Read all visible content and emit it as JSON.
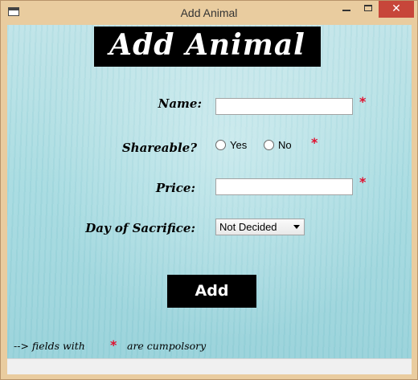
{
  "window": {
    "title": "Add Animal",
    "close_glyph": "✕"
  },
  "form": {
    "heading": "Add Animal",
    "name_label": "Name:",
    "shareable_label": "Shareable?",
    "price_label": "Price:",
    "day_label": "Day of Sacrifice:",
    "name_value": "",
    "price_value": "",
    "radio_yes": "Yes",
    "radio_no": "No",
    "day_selected": "Not Decided",
    "required_mark": "*",
    "add_button": "Add"
  },
  "footer": {
    "prefix": "--> fields with",
    "star": "*",
    "suffix": "are cumpolsory"
  },
  "colors": {
    "required": "#e0102e",
    "heading_bg": "#000000",
    "close_button": "#c7463a"
  }
}
